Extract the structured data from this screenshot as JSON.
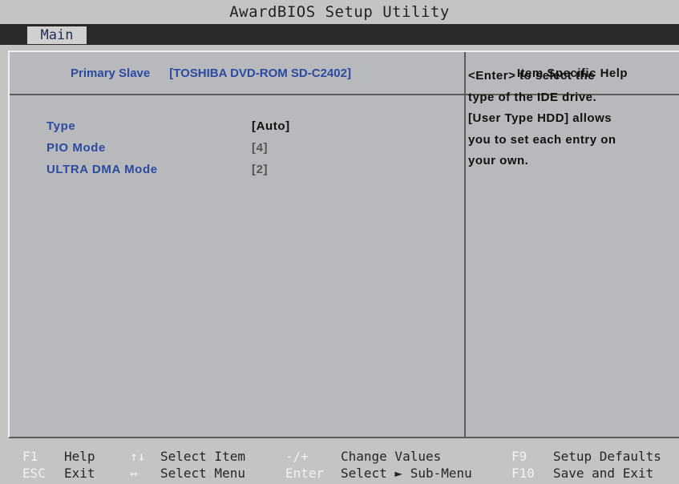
{
  "title": "AwardBIOS Setup Utility",
  "menu": {
    "active_tab": "Main"
  },
  "header": {
    "item_label": "Primary Slave",
    "item_value": "[TOSHIBA DVD-ROM SD-C2402]",
    "help_title": "Item Specific Help"
  },
  "fields": [
    {
      "label": "Type",
      "value": "[Auto]"
    },
    {
      "label": "PIO Mode",
      "value": "[4]"
    },
    {
      "label": "ULTRA DMA Mode",
      "value": "[2]"
    }
  ],
  "help": {
    "lines": [
      "<Enter> to select the",
      "type of the IDE drive.",
      "[User Type HDD] allows",
      "you to set each entry on",
      "your own."
    ]
  },
  "footer": {
    "row1": [
      {
        "key": "F1",
        "desc": "Help"
      },
      {
        "key": "↑↓",
        "desc": "Select Item"
      },
      {
        "key": "-/+",
        "desc": "Change Values"
      },
      {
        "key": "F9",
        "desc": "Setup Defaults"
      }
    ],
    "row2": [
      {
        "key": "ESC",
        "desc": "Exit"
      },
      {
        "key": "↔",
        "desc": "Select Menu"
      },
      {
        "key": "Enter",
        "desc": "Select ► Sub-Menu"
      },
      {
        "key": "F10",
        "desc": "Save and Exit"
      }
    ]
  },
  "colors": {
    "background": "#c4c4c4",
    "panel": "#b7b9bd",
    "menu_bar": "#2a2a2a",
    "field_label": "#2b4aa0",
    "key_text": "#f2f2f2"
  }
}
